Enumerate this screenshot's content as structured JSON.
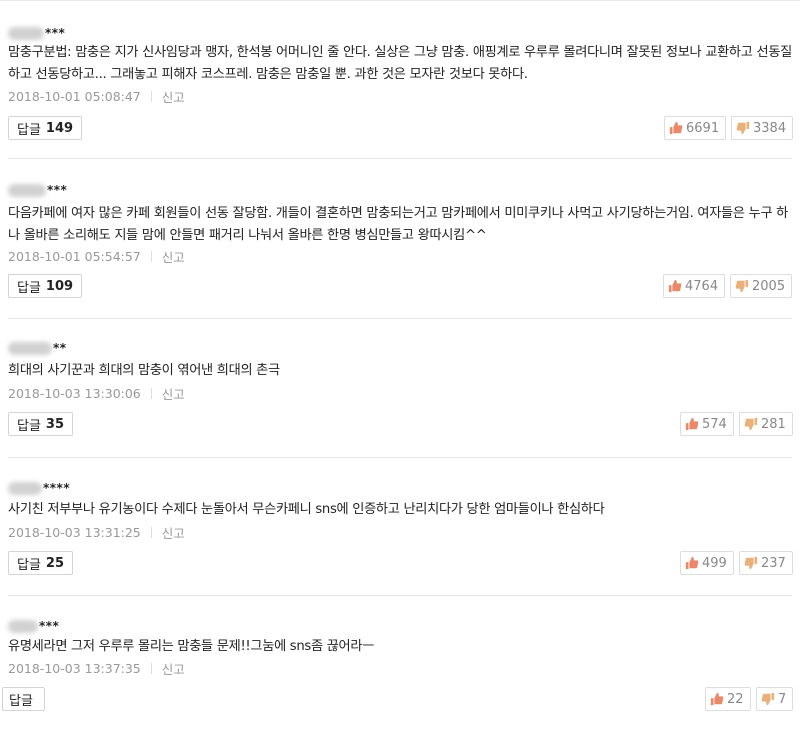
{
  "ui": {
    "report_label": "신고",
    "reply_label": "답글",
    "accent_like": "#e9896a",
    "accent_dislike": "#e9b07a"
  },
  "comments": [
    {
      "author_suffix": "***",
      "text": "맘충구분법: 맘충은 지가 신사임당과 맹자, 한석봉 어머니인 줄 안다. 실상은 그냥 맘충. 애핑계로 우루루 몰려다니며 잘못된 정보나 교환하고 선동질하고 선동당하고... 그래놓고 피해자 코스프레. 맘충은 맘충일 뿐. 과한 것은 모자란 것보다 못하다.",
      "date": "2018-10-01 05:08:47",
      "reply_count": "149",
      "likes": "6691",
      "dislikes": "3384"
    },
    {
      "author_suffix": "***",
      "text": "다음카페에 여자 많은 카페 회원들이 선동 잘당함. 개들이 결혼하면 맘충되는거고 맘카페에서 미미쿠키나 사먹고 사기당하는거임. 여자들은 누구 하나 올바른 소리해도 지들 맘에 안들면 패거리 나눠서 올바른 한명 병심만들고 왕따시킴^^",
      "date": "2018-10-01 05:54:57",
      "reply_count": "109",
      "likes": "4764",
      "dislikes": "2005"
    },
    {
      "author_suffix": "**",
      "text": "희대의 사기꾼과 희대의 맘충이 엮어낸 희대의 촌극",
      "date": "2018-10-03 13:30:06",
      "reply_count": "35",
      "likes": "574",
      "dislikes": "281"
    },
    {
      "author_suffix": "****",
      "text": "사기친 저부부나 유기농이다 수제다 눈돌아서 무슨카페니 sns에 인증하고 난리치다가 당한 엄마들이나 한심하다",
      "date": "2018-10-03 13:31:25",
      "reply_count": "25",
      "likes": "499",
      "dislikes": "237"
    },
    {
      "author_suffix": "***",
      "text": "유명세라면 그저 우루루 몰리는 맘충들 문제!!그눔에 sns좀 끊어라ㅡ",
      "date": "2018-10-03 13:37:35",
      "reply_count": "",
      "likes": "22",
      "dislikes": "7"
    }
  ]
}
